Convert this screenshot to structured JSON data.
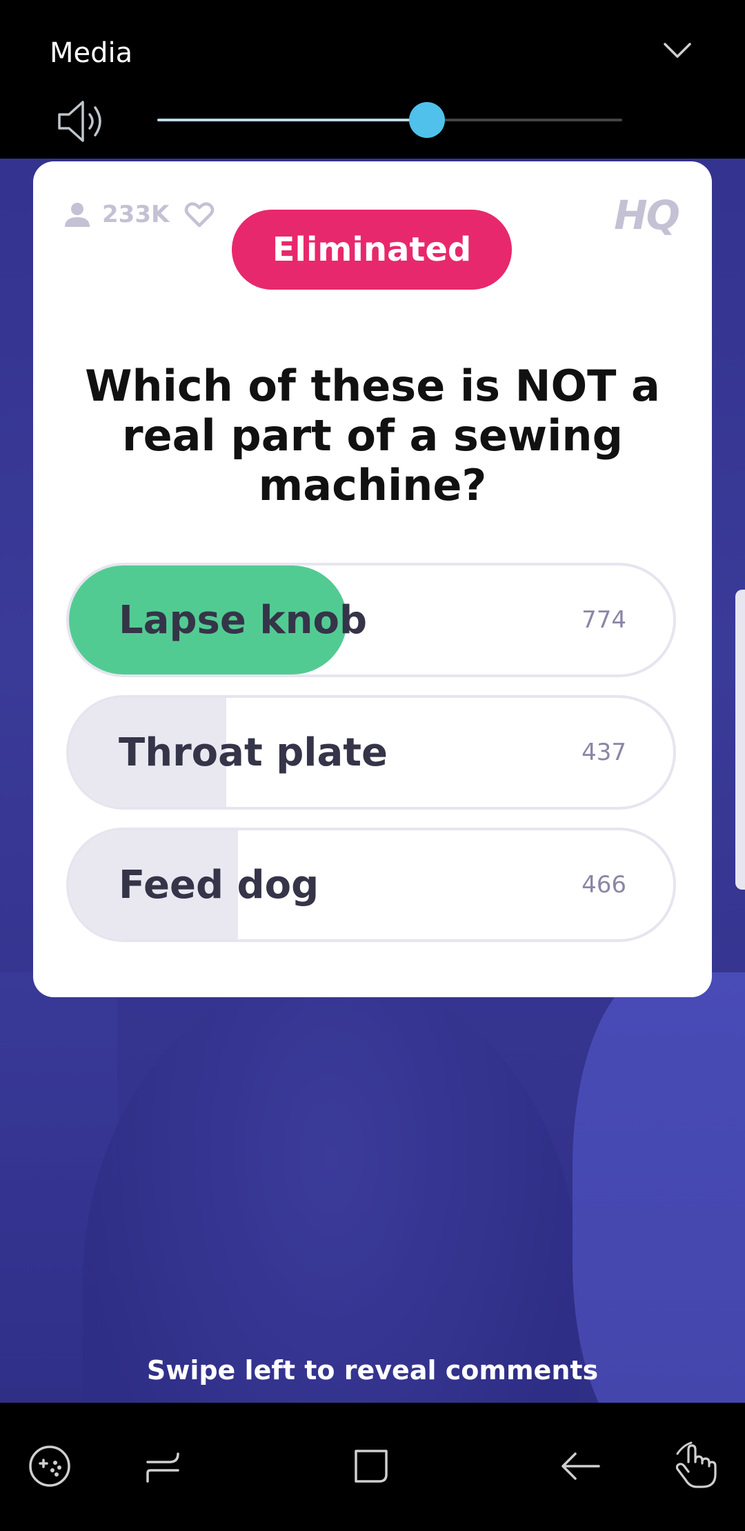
{
  "media_panel": {
    "title": "Media",
    "volume_level": 0.58
  },
  "card": {
    "viewer_count": "233K",
    "logo": "HQ",
    "status_badge": "Eliminated",
    "question": "Which of these is NOT a real part of a sewing machine?",
    "answers": [
      {
        "label": "Lapse knob",
        "count": "774",
        "fill_fraction": 0.46,
        "fill_color": "#52cb93"
      },
      {
        "label": "Throat plate",
        "count": "437",
        "fill_fraction": 0.26,
        "fill_color": "#e9e8f1"
      },
      {
        "label": "Feed dog",
        "count": "466",
        "fill_fraction": 0.28,
        "fill_color": "#e9e8f1"
      }
    ]
  },
  "footer_hint": "Swipe left to reveal comments",
  "navbar": {
    "icons": [
      "game-tools-icon",
      "recent-apps-icon",
      "home-icon",
      "back-icon",
      "assistant-touch-icon"
    ]
  },
  "colors": {
    "accent_pink": "#e8286c",
    "correct_green": "#52cb93",
    "background_purple": "#35348f",
    "slider_blue": "#4fc1ea"
  }
}
